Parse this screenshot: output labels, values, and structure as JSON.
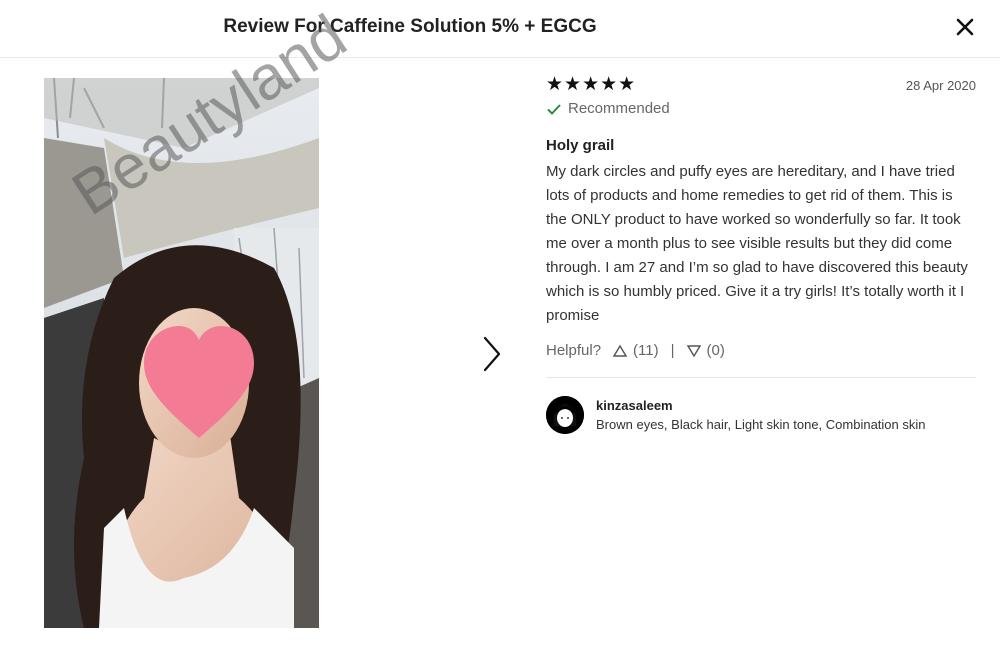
{
  "header": {
    "title": "Review For Caffeine Solution 5% + EGCG"
  },
  "photo": {
    "watermark": "Beautyland"
  },
  "review": {
    "stars": "★★★★★",
    "rating": 5,
    "date": "28 Apr 2020",
    "recommended": "Recommended",
    "title": "Holy grail",
    "body": "My dark circles and puffy eyes are hereditary, and I have tried lots of products and home remedies to get rid of them. This is the ONLY product to have worked so wonderfully so far. It took me over a month plus to see visible results but they did come through. I am 27 and I’m so glad to have discovered this beauty which is so humbly priced. Give it a try girls! It’s totally worth it I promise",
    "helpful_label": "Helpful?",
    "upvotes": "(11)",
    "separator": "|",
    "downvotes": "(0)"
  },
  "user": {
    "name": "kinzasaleem",
    "traits": "Brown eyes, Black hair, Light skin tone, Combination skin"
  },
  "colors": {
    "check": "#2a8a3e",
    "heart": "#f47b94",
    "text": "#222222"
  },
  "icons": {
    "close": "close-icon",
    "next": "chevron-right-icon",
    "up": "triangle-up-icon",
    "down": "triangle-down-icon",
    "check": "check-icon"
  }
}
